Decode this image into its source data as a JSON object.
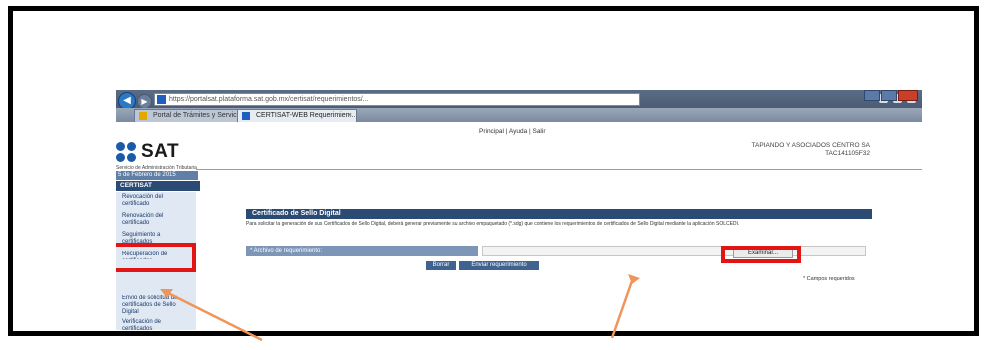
{
  "browser": {
    "url": "https://portalsat.plataforma.sat.gob.mx/certisat/requerimientos/...",
    "tabs": [
      {
        "label": "Portal de Trámites y Servicios -"
      },
      {
        "label": "CERTISAT-WEB Requerimien..."
      }
    ],
    "tab_close": "×"
  },
  "header": {
    "top_links": "Principal  |  Ayuda  |  Salir",
    "logo_text": "SAT",
    "logo_subtitle": "Servicio de Administración Tributaria",
    "company_name": "TAPIANDO Y ASOCIADOS CENTRO SA",
    "company_rfc": "TAC141105F32"
  },
  "sidebar": {
    "date": "5 de Febrero de 2015",
    "section_title": "CERTISAT",
    "items": [
      {
        "label": "Revocación del certificado"
      },
      {
        "label": "Renovación del certificado"
      },
      {
        "label": "Seguimiento a certificados"
      },
      {
        "label": "Recuperación de certificados"
      },
      {
        "label": "Envío de solicitud de certificados de Sello Digital"
      },
      {
        "label": "Verificación de certificados"
      }
    ]
  },
  "main": {
    "panel_title": "Certificado de Sello Digital",
    "instructions": "Para solicitar la generación de sus Certificados de Sello Digital, deberá generar previamente su archivo empaquetado (*.sdg) que contiene los requerimientos de certificados de Sello Digital mediante la aplicación SOLCEDI.",
    "file_label": "* Archivo de requerimiento:",
    "browse_label": "Examinar...",
    "clear_label": "Borrar",
    "submit_label": "Enviar requerimiento",
    "required_note": "* Campos requeridos"
  },
  "colors": {
    "highlight": "#e21515",
    "arrow": "#f0955a",
    "nav_dark": "#2b4a74"
  }
}
